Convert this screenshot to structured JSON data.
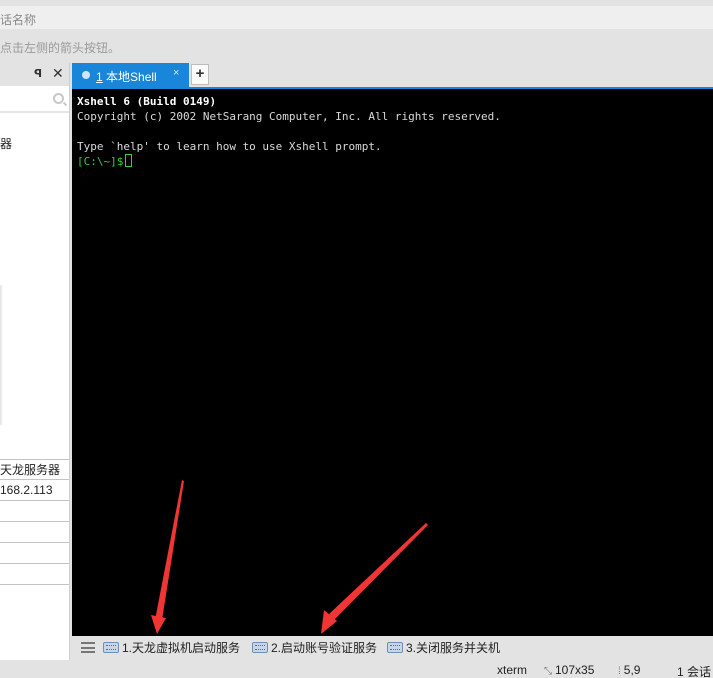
{
  "session_name_bar": {
    "placeholder": "话名称"
  },
  "hint_bar": {
    "text": "点击左侧的箭头按钮。"
  },
  "left_panel": {
    "tree_item": "器",
    "properties": [
      "天龙服务器",
      "168.2.113",
      "",
      "",
      "",
      ""
    ]
  },
  "tabs": [
    {
      "number": "1",
      "label": "本地Shell",
      "active": true,
      "close": "×"
    }
  ],
  "tab_add_label": "+",
  "terminal": {
    "lines": [
      {
        "text": "Xshell 6 (Build 0149)",
        "bold": true
      },
      {
        "text": "Copyright (c) 2002 NetSarang Computer, Inc. All rights reserved.",
        "bold": false
      },
      {
        "text": "",
        "bold": false
      },
      {
        "text": "Type `help' to learn how to use Xshell prompt.",
        "bold": false
      }
    ],
    "prompt": "[C:\\~]$",
    "prompt_color": "#36d13a"
  },
  "quick_commands": [
    {
      "label": "1.天龙虚拟机启动服务"
    },
    {
      "label": "2.启动账号验证服务"
    },
    {
      "label": "3.关闭服务并关机"
    }
  ],
  "status_bar": {
    "terminal_type": "xterm",
    "size": "107x35",
    "cursor_pos": "5,9",
    "sessions": "1 会话"
  },
  "colors": {
    "tab_active": "#1a86d9",
    "annotation_arrow": "#f03535"
  }
}
